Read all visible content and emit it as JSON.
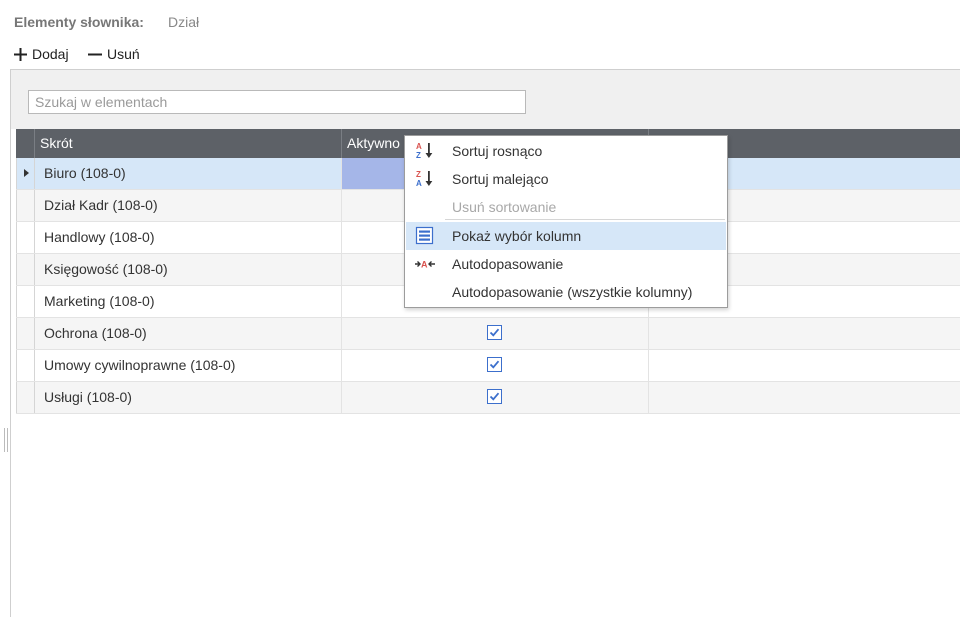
{
  "header": {
    "dictionary_label": "Elementy słownika:",
    "dictionary_value": "Dział"
  },
  "toolbar": {
    "add_label": "Dodaj",
    "remove_label": "Usuń",
    "add_icon": "plus-icon",
    "remove_icon": "minus-icon"
  },
  "search": {
    "placeholder": "Szukaj w elementach",
    "value": ""
  },
  "grid": {
    "columns": [
      "Skrót",
      "Aktywno"
    ],
    "rows": [
      {
        "name": "Biuro (108-0)",
        "active": true,
        "selected": true
      },
      {
        "name": "Dział Kadr (108-0)",
        "active": true
      },
      {
        "name": "Handlowy (108-0)",
        "active": true
      },
      {
        "name": "Księgowość (108-0)",
        "active": true
      },
      {
        "name": "Marketing (108-0)",
        "active": true
      },
      {
        "name": "Ochrona (108-0)",
        "active": true
      },
      {
        "name": "Umowy cywilnoprawne (108-0)",
        "active": true
      },
      {
        "name": "Usługi (108-0)",
        "active": true
      }
    ]
  },
  "context_menu": {
    "items": [
      {
        "label": "Sortuj rosnąco",
        "icon": "sort-ascending-icon",
        "enabled": true
      },
      {
        "label": "Sortuj malejąco",
        "icon": "sort-descending-icon",
        "enabled": true
      },
      {
        "label": "Usuń sortowanie",
        "icon": "",
        "enabled": false
      },
      {
        "label": "Pokaż wybór kolumn",
        "icon": "column-chooser-icon",
        "enabled": true,
        "highlighted": true
      },
      {
        "label": "Autodopasowanie",
        "icon": "autofit-icon",
        "enabled": true
      },
      {
        "label": "Autodopasowanie (wszystkie kolumny)",
        "icon": "",
        "enabled": true
      }
    ]
  },
  "colors": {
    "header_bg": "#5d6167",
    "selected_row": "#d6e7f8",
    "selected_cell": "#a5b6e8",
    "checkbox": "#3c6fcc"
  }
}
